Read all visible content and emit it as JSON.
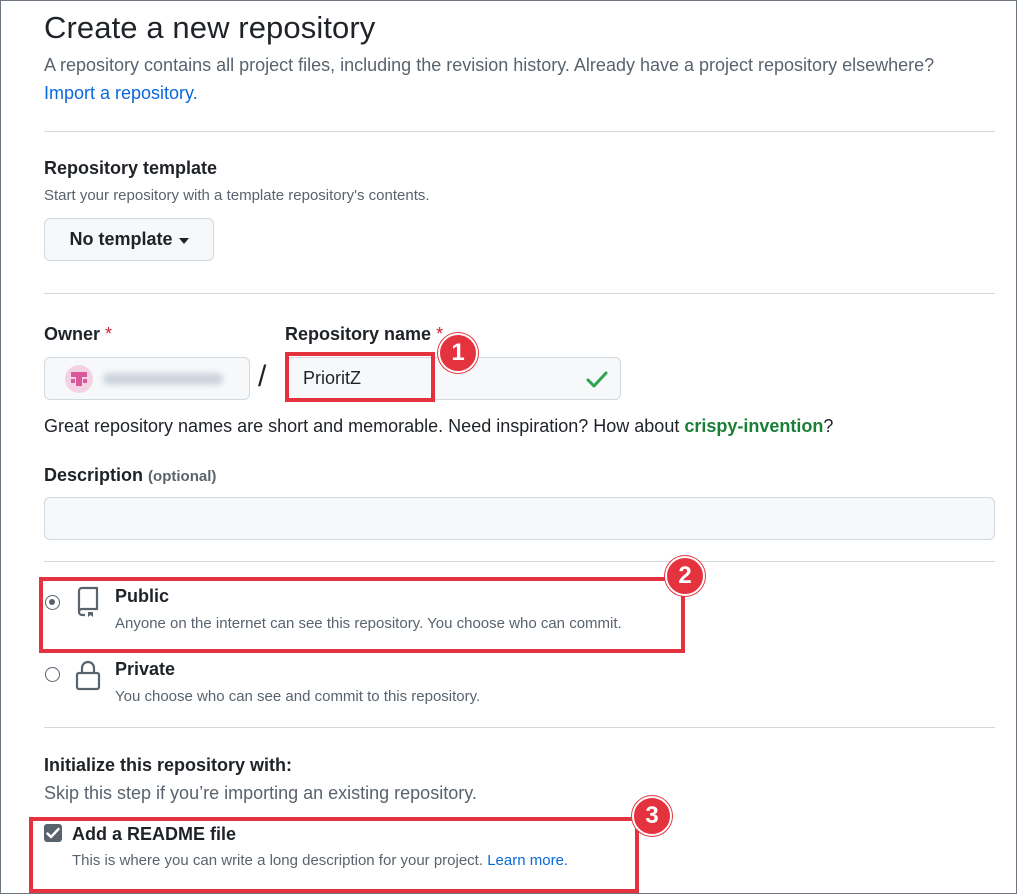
{
  "header": {
    "title": "Create a new repository",
    "subtitle": "A repository contains all project files, including the revision history. Already have a project repository elsewhere?",
    "import_link": "Import a repository."
  },
  "template": {
    "label": "Repository template",
    "hint": "Start your repository with a template repository's contents.",
    "button_label": "No template"
  },
  "owner": {
    "label": "Owner",
    "required_mark": "*"
  },
  "repo_name": {
    "label": "Repository name",
    "required_mark": "*",
    "value": "PrioritZ",
    "valid_icon": "check-icon"
  },
  "separator": "/",
  "name_helper": {
    "text_before": "Great repository names are short and memorable. Need inspiration? How about ",
    "suggestion": "crispy-invention",
    "text_after": "?"
  },
  "description": {
    "label": "Description",
    "optional": "(optional)",
    "value": ""
  },
  "visibility": {
    "selected": "public",
    "options": [
      {
        "title": "Public",
        "desc": "Anyone on the internet can see this repository. You choose who can commit.",
        "icon": "repo-icon"
      },
      {
        "title": "Private",
        "desc": "You choose who can see and commit to this repository.",
        "icon": "lock-icon"
      }
    ]
  },
  "init": {
    "title": "Initialize this repository with:",
    "hint": "Skip this step if you’re importing an existing repository.",
    "readme_label": "Add a README file",
    "readme_checked": true,
    "readme_desc": "This is where you can write a long description for your project.",
    "learn_more": "Learn more."
  },
  "annotations": [
    "1",
    "2",
    "3"
  ],
  "colors": {
    "accent_link": "#0969da",
    "annotation_red": "#e5323f",
    "success_green": "#1a7f37"
  }
}
